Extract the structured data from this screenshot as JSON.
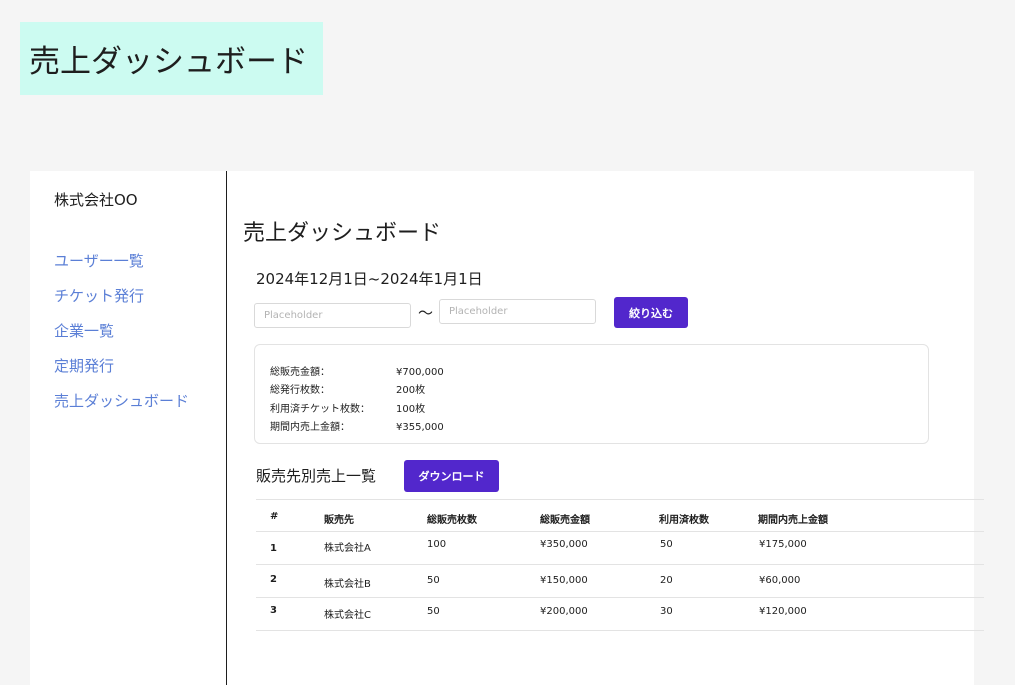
{
  "badge_title": "売上ダッシュボード",
  "sidebar": {
    "company": "株式会社OO",
    "items": [
      {
        "label": "ユーザー一覧"
      },
      {
        "label": "チケット発行"
      },
      {
        "label": "企業一覧"
      },
      {
        "label": "定期発行"
      },
      {
        "label": "売上ダッシュボード"
      }
    ]
  },
  "main": {
    "title": "売上ダッシュボード",
    "date_range": "2024年12月1日~2024年1月1日",
    "filter": {
      "from_placeholder": "Placeholder",
      "separator": "〜",
      "to_placeholder": "Placeholder",
      "button_label": "絞り込む"
    },
    "summary": [
      {
        "label": "総販売金額：",
        "value": "¥700,000"
      },
      {
        "label": "総発行枚数：",
        "value": "200枚"
      },
      {
        "label": "利用済チケット枚数：",
        "value": "100枚"
      },
      {
        "label": "期間内売上金額：",
        "value": "¥355,000"
      }
    ],
    "section_title": "販売先別売上一覧",
    "download_label": "ダウンロード",
    "table": {
      "headers": [
        "#",
        "販売先",
        "総販売枚数",
        "総販売金額",
        "利用済枚数",
        "期間内売上金額"
      ],
      "rows": [
        [
          "1",
          "株式会社A",
          "100",
          "¥350,000",
          "50",
          "¥175,000"
        ],
        [
          "2",
          "株式会社B",
          "50",
          "¥150,000",
          "20",
          "¥60,000"
        ],
        [
          "3",
          "株式会社C",
          "50",
          "¥200,000",
          "30",
          "¥120,000"
        ]
      ]
    }
  },
  "colors": {
    "accent": "#5227cc",
    "link": "#5b7fd6",
    "badge_bg": "#ccfbf1"
  }
}
